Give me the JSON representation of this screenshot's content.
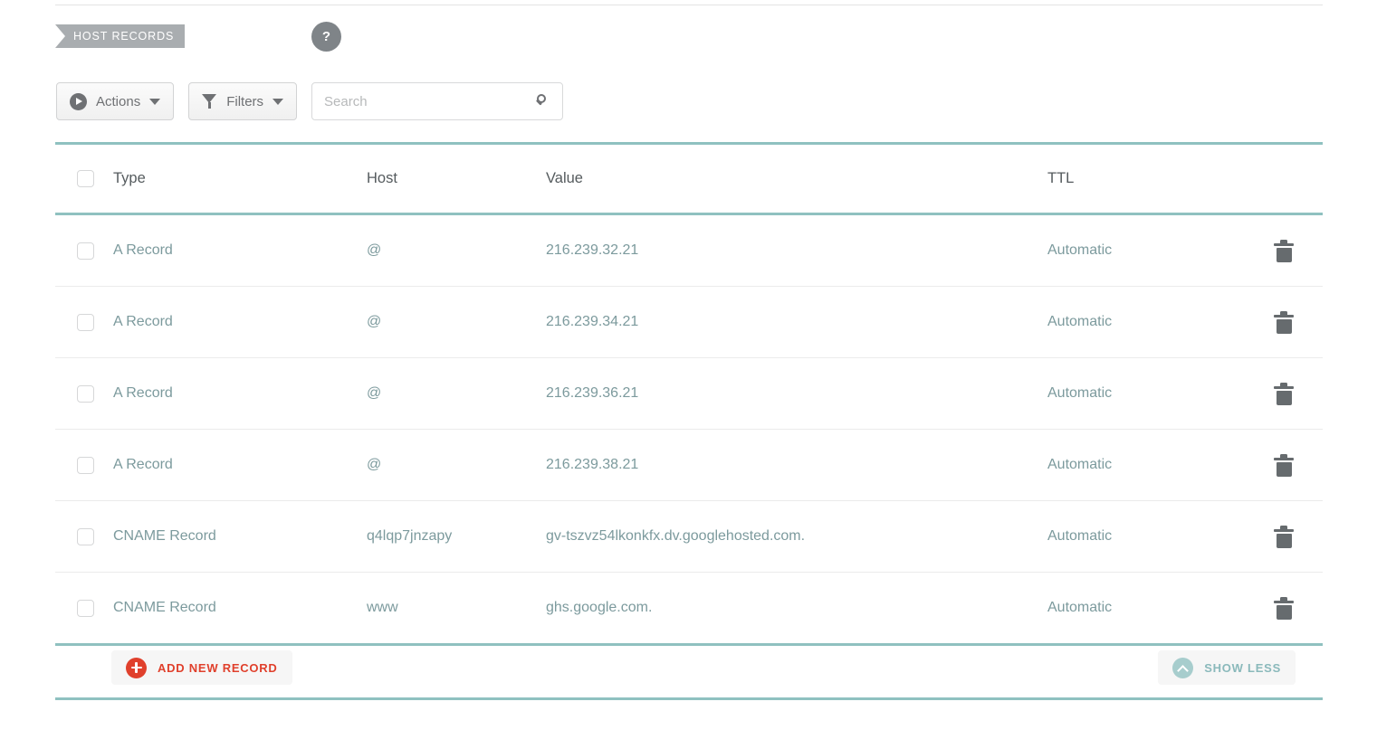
{
  "section": {
    "tag_label": "HOST RECORDS",
    "help_label": "?"
  },
  "toolbar": {
    "actions_label": "Actions",
    "filters_label": "Filters",
    "search_placeholder": "Search",
    "search_value": ""
  },
  "table": {
    "columns": {
      "type": "Type",
      "host": "Host",
      "value": "Value",
      "ttl": "TTL"
    },
    "rows": [
      {
        "type": "A Record",
        "host": "@",
        "value": "216.239.32.21",
        "ttl": "Automatic"
      },
      {
        "type": "A Record",
        "host": "@",
        "value": "216.239.34.21",
        "ttl": "Automatic"
      },
      {
        "type": "A Record",
        "host": "@",
        "value": "216.239.36.21",
        "ttl": "Automatic"
      },
      {
        "type": "A Record",
        "host": "@",
        "value": "216.239.38.21",
        "ttl": "Automatic"
      },
      {
        "type": "CNAME Record",
        "host": "q4lqp7jnzapy",
        "value": "gv-tszvz54lkonkfx.dv.googlehosted.com.",
        "ttl": "Automatic"
      },
      {
        "type": "CNAME Record",
        "host": "www",
        "value": "ghs.google.com.",
        "ttl": "Automatic"
      }
    ]
  },
  "footer": {
    "add_label": "ADD NEW RECORD",
    "show_less_label": "SHOW LESS"
  },
  "colors": {
    "teal_rule": "#8fc1c0",
    "row_text": "#7c9a9d",
    "header_text": "#555b5e",
    "add_red": "#e0402c",
    "show_less_teal": "#8ab9bb",
    "tag_grey": "#a9adb0"
  }
}
